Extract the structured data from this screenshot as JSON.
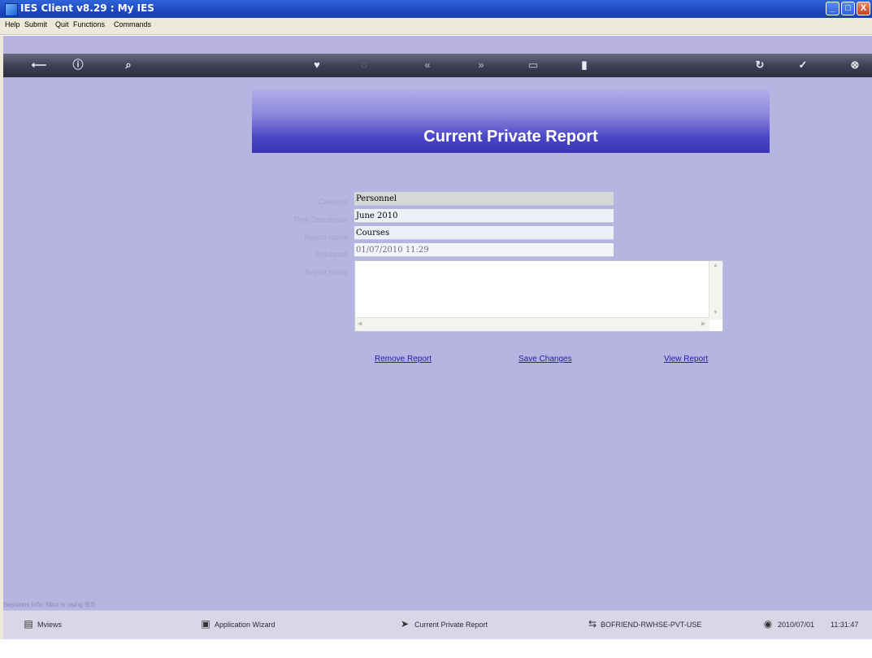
{
  "window": {
    "title": "IES Client v8.29 : My IES",
    "min": "_",
    "max": "□",
    "close": "X"
  },
  "menu": [
    "Help",
    "Submit",
    "Quit",
    "Functions",
    "Commands"
  ],
  "toolbar": {
    "icons": [
      "back-arrow-icon",
      "info-icon",
      "search-icon",
      "heart-icon",
      "refresh-icon",
      "rewind-icon",
      "forward-icon",
      "list-icon",
      "page-icon",
      "history-icon",
      "check-icon",
      "close-icon"
    ]
  },
  "page": {
    "title": "Current Private Report"
  },
  "form": {
    "category_label": "Category",
    "category": "Personnel",
    "time_label": "Time Description",
    "time": "June 2010",
    "report_name_label": "Report Name",
    "report_name": "Courses",
    "published_label": "Published",
    "published": "01/07/2010 11:29",
    "notes_label": "Report Notes",
    "notes": ""
  },
  "actions": {
    "remove": "Remove Report",
    "save": "Save Changes",
    "view": "View Report"
  },
  "status": {
    "text": "Sessions Info: Nico is using IES"
  },
  "taskbar": {
    "views": "Mviews",
    "wizard": "Application Wizard",
    "current": "Current Private Report",
    "path": "BOFRIEND-RWHSE-PVT-USE",
    "date": "2010/07/01",
    "time": "11:31:47"
  }
}
